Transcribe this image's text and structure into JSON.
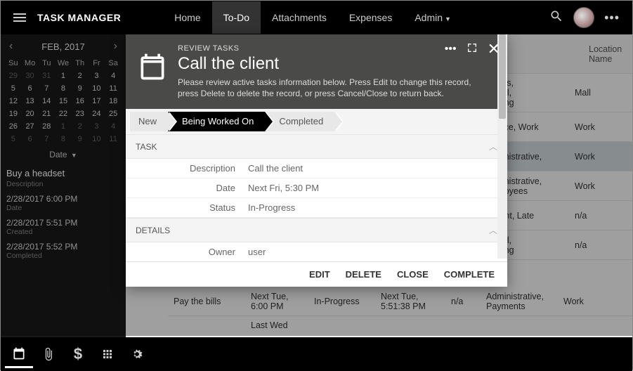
{
  "app": {
    "title": "TASK MANAGER"
  },
  "nav": {
    "home": "Home",
    "todo": "To-Do",
    "attachments": "Attachments",
    "expenses": "Expenses",
    "admin": "Admin"
  },
  "calendar": {
    "month": "FEB, 2017",
    "dow": [
      "Su",
      "Mo",
      "Tu",
      "We",
      "Th",
      "Fr",
      "Sa"
    ],
    "weeks": [
      [
        {
          "n": "29",
          "dim": true
        },
        {
          "n": "30",
          "dim": true
        },
        {
          "n": "31",
          "dim": true
        },
        {
          "n": "1"
        },
        {
          "n": "2"
        },
        {
          "n": "3"
        },
        {
          "n": "4"
        }
      ],
      [
        {
          "n": "5"
        },
        {
          "n": "6"
        },
        {
          "n": "7"
        },
        {
          "n": "8"
        },
        {
          "n": "9"
        },
        {
          "n": "10"
        },
        {
          "n": "11"
        }
      ],
      [
        {
          "n": "12"
        },
        {
          "n": "13"
        },
        {
          "n": "14"
        },
        {
          "n": "15"
        },
        {
          "n": "16"
        },
        {
          "n": "17"
        },
        {
          "n": "18"
        }
      ],
      [
        {
          "n": "19"
        },
        {
          "n": "20"
        },
        {
          "n": "21"
        },
        {
          "n": "22"
        },
        {
          "n": "23"
        },
        {
          "n": "24"
        },
        {
          "n": "25"
        }
      ],
      [
        {
          "n": "26"
        },
        {
          "n": "27"
        },
        {
          "n": "28"
        },
        {
          "n": "1",
          "dim": true
        },
        {
          "n": "2",
          "dim": true
        },
        {
          "n": "3",
          "dim": true
        },
        {
          "n": "4",
          "dim": true
        }
      ],
      [
        {
          "n": "5",
          "dim": true
        },
        {
          "n": "6",
          "dim": true
        },
        {
          "n": "7",
          "dim": true
        },
        {
          "n": "8",
          "dim": true
        },
        {
          "n": "9",
          "dim": true
        },
        {
          "n": "10",
          "dim": true
        },
        {
          "n": "11",
          "dim": true
        }
      ]
    ],
    "dropdown": "Date"
  },
  "sidepanel": {
    "title": "Buy a headset",
    "description_label": "Description",
    "date_value": "2/28/2017 6:00 PM",
    "date_label": "Date",
    "created_value": "2/28/2017 5:51 PM",
    "created_label": "Created",
    "completed_value": "2/28/2017 5:52 PM",
    "completed_label": "Completed"
  },
  "modal": {
    "eyebrow": "REVIEW TASKS",
    "title": "Call the client",
    "desc": "Please review active tasks information below. Press Edit to change this record, press Delete to delete the record, or press Cancel/Close to return back.",
    "steps": {
      "new": "New",
      "working": "Being Worked On",
      "completed": "Completed"
    },
    "sections": {
      "task": "TASK",
      "details": "DETAILS"
    },
    "fields": {
      "description_label": "Description",
      "description_value": "Call the client",
      "date_label": "Date",
      "date_value": "Next Fri, 5:30 PM",
      "status_label": "Status",
      "status_value": "In-Progress",
      "owner_label": "Owner",
      "owner_value": "user"
    },
    "actions": {
      "edit": "EDIT",
      "delete": "DELETE",
      "close": "CLOSE",
      "complete": "COMPLETE"
    }
  },
  "grid": {
    "head": {
      "loc": "Location Name"
    },
    "rows": [
      {
        "tags": "ses,\nnal,\nping",
        "loc": "Mall"
      },
      {
        "tags": "ffice, Work",
        "loc": "Work"
      },
      {
        "tags": "ninistrative,",
        "loc": "Work",
        "sel": true
      },
      {
        "tags": "ninistrative,\nployees",
        "loc": "Work"
      },
      {
        "tags": "tant, Late",
        "loc": "n/a"
      },
      {
        "tags": "nal,\nping",
        "loc": "n/a"
      }
    ],
    "bottomrow": {
      "desc": "Pay the bills",
      "date": "Next Tue, 6:00 PM",
      "status": "In-Progress",
      "created": "Next Tue, 5:51:38 PM",
      "completed": "n/a",
      "tags": "Administrative, Payments",
      "loc": "Work"
    },
    "lastrow": {
      "date": "Last Wed"
    }
  }
}
